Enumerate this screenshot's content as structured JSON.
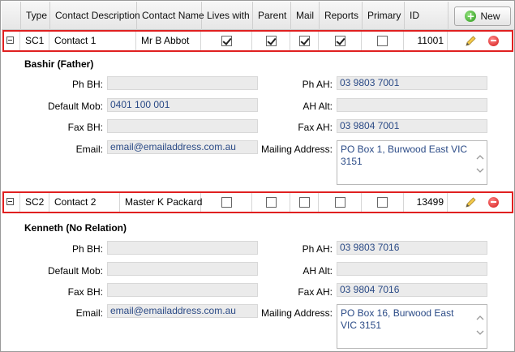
{
  "header": {
    "columns": {
      "type": "Type",
      "description": "Contact Description",
      "name": "Contact Name",
      "lives_with": "Lives with",
      "parent": "Parent",
      "mail": "Mail",
      "reports": "Reports",
      "primary": "Primary",
      "id": "ID"
    },
    "new_button_label": "New"
  },
  "field_labels": {
    "ph_bh": "Ph BH:",
    "ph_ah": "Ph AH:",
    "default_mob": "Default Mob:",
    "ah_alt": "AH Alt:",
    "fax_bh": "Fax BH:",
    "fax_ah": "Fax AH:",
    "email": "Email:",
    "mailing_address": "Mailing Address:"
  },
  "contacts": [
    {
      "type": "SC1",
      "description": "Contact 1",
      "name": "Mr B Abbot",
      "lives_with": true,
      "parent": true,
      "mail": true,
      "reports": true,
      "primary": false,
      "id": "11001",
      "detail_name": "Bashir (Father)",
      "ph_bh": "",
      "ph_ah": "03 9803 7001",
      "default_mob": "0401 100 001",
      "ah_alt": "",
      "fax_bh": "",
      "fax_ah": "03 9804 7001",
      "email": "email@emailaddress.com.au",
      "mailing_address": "PO Box 1, Burwood East VIC 3151"
    },
    {
      "type": "SC2",
      "description": "Contact 2",
      "name": "Master K Packard",
      "lives_with": false,
      "parent": false,
      "mail": false,
      "reports": false,
      "primary": false,
      "id": "13499",
      "detail_name": "Kenneth (No Relation)",
      "ph_bh": "",
      "ph_ah": "03 9803 7016",
      "default_mob": "",
      "ah_alt": "",
      "fax_bh": "",
      "fax_ah": "03 9804 7016",
      "email": "email@emailaddress.com.au",
      "mailing_address": "PO Box 16, Burwood East VIC 3151"
    }
  ],
  "colors": {
    "row_highlight": "#e02020",
    "value_text": "#2a4a86",
    "readonly_bg": "#ebebeb"
  },
  "icons": {
    "expander": "collapse-minus-icon",
    "edit": "pencil-icon",
    "delete": "delete-minus-circle-icon",
    "new": "plus-circle-icon",
    "scroll_up": "chevron-up-icon",
    "scroll_down": "chevron-down-icon"
  }
}
